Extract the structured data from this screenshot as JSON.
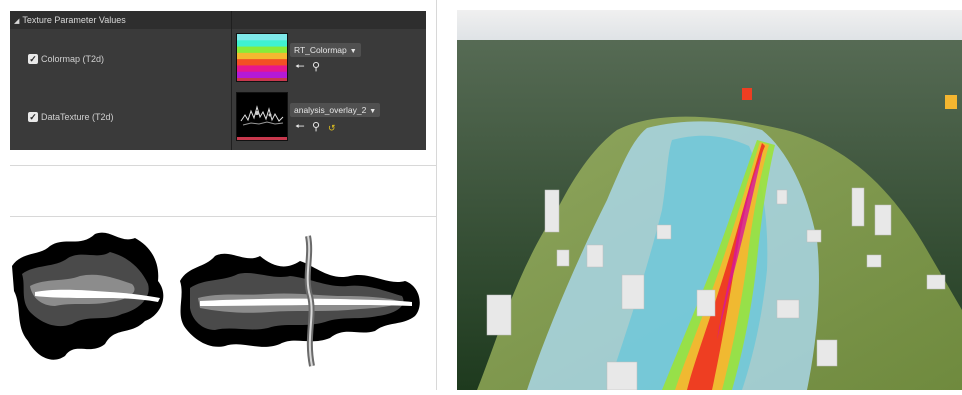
{
  "panel": {
    "header": "Texture Parameter Values",
    "params": [
      {
        "label": "Colormap (T2d)",
        "checked": true,
        "asset": "RT_Colormap",
        "colormap_colors": [
          "#7fe9ea",
          "#3ff2d0",
          "#88ec3a",
          "#f5b830",
          "#f35024",
          "#e6178e",
          "#b41ad6"
        ]
      },
      {
        "label": "DataTexture (T2d)",
        "checked": true,
        "asset": "analysis_overlay_2"
      }
    ],
    "icons": {
      "use_asset": "arrow-left-icon",
      "browse": "search-icon",
      "reset": "reset-arrow-icon"
    }
  },
  "colors": {
    "panel_bg": "#3a3a3a",
    "header_bg": "#2e2e2e",
    "reset_yellow": "#e0c020"
  }
}
